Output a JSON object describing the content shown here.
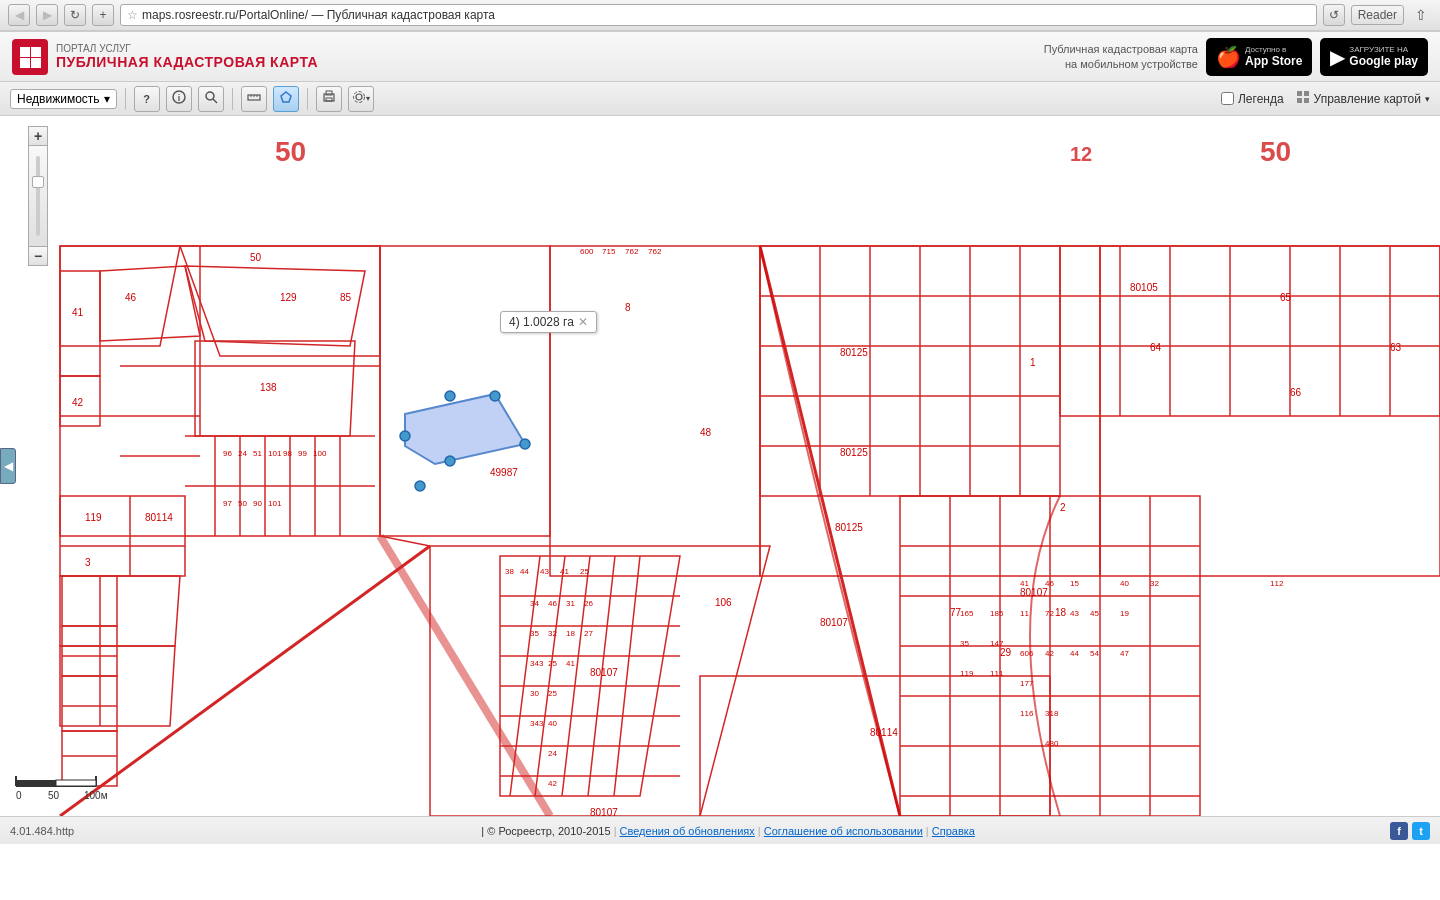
{
  "browser": {
    "url": "maps.rosreestr.ru/PortalOnline/ — Публичная кадастровая карта",
    "reader_label": "Reader"
  },
  "header": {
    "portal_label": "ПОРТАЛ УСЛУГ",
    "title": "ПУБЛИЧНАЯ КАДАСТРОВАЯ КАРТА",
    "store_label": "Публичная кадастровая карта\nна мобильном устройстве",
    "appstore_top": "Доступно в",
    "appstore_bottom": "App Store",
    "googleplay_top": "ЗАГРУЗИТЕ НА",
    "googleplay_bottom": "Google play"
  },
  "toolbar": {
    "property_select": "Недвижимость",
    "legend_label": "Легенда",
    "manage_label": "Управление картой"
  },
  "map": {
    "measurement_label": "4) 1.0028 га",
    "close_icon": "✕"
  },
  "scale": {
    "labels": [
      "0",
      "50",
      "100м"
    ]
  },
  "status": {
    "version": "4.01.484.http",
    "copyright": "© Росреестр, 2010-2015",
    "update_link": "Сведения об обновлениях",
    "terms_link": "Соглашение об использовании",
    "help_link": "Справка"
  }
}
